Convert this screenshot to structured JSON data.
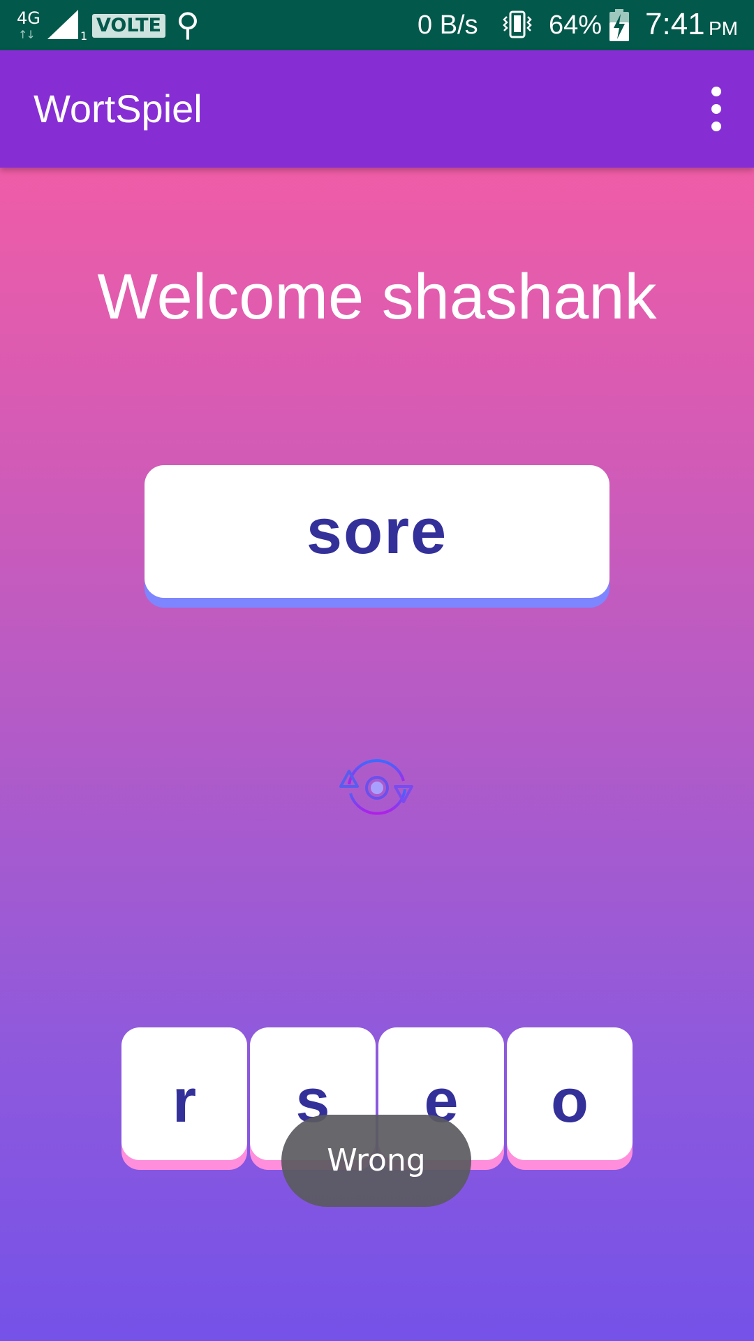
{
  "status_bar": {
    "network": "4G",
    "network_arrows": "↑↓",
    "sim": "1",
    "volte": "VOLTE",
    "usb_icon": "usb-icon",
    "data_speed": "0 B/s",
    "battery_percent": "64%",
    "time": "7:41",
    "ampm": "PM"
  },
  "app_bar": {
    "title": "WortSpiel",
    "overflow_icon": "more-vert-icon"
  },
  "main": {
    "welcome": "Welcome shashank",
    "word": "sore",
    "shuffle_icon": "shuffle-icon",
    "tiles": [
      "r",
      "s",
      "e",
      "o"
    ]
  },
  "toast": {
    "message": "Wrong"
  },
  "colors": {
    "status_bar": "#02584a",
    "app_bar": "#862ed4",
    "gradient_top": "#ff5e9e",
    "gradient_bottom": "#7552e8",
    "letter_text": "#34309a",
    "word_card_shadow": "#7d86ff",
    "tile_shadow": "#ff8fdc"
  }
}
